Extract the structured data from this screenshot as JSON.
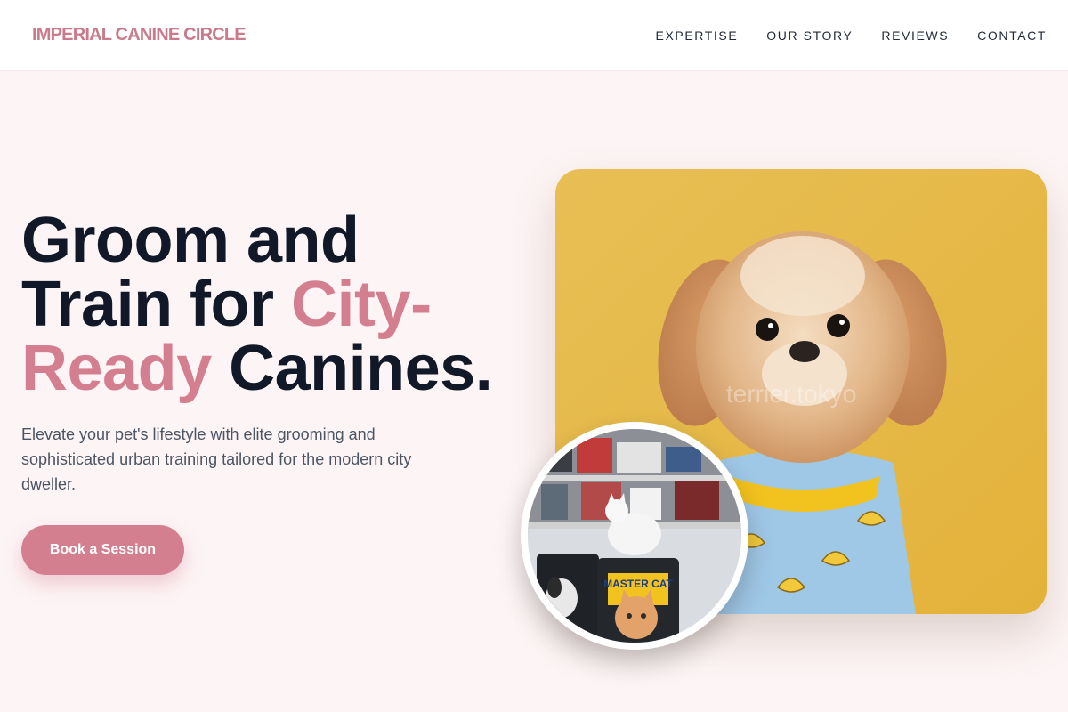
{
  "brand": {
    "name": "IMPERIAL CANINE CIRCLE",
    "accent_color": "#d47f8f"
  },
  "nav": {
    "links": [
      {
        "label": "EXPERTISE"
      },
      {
        "label": "OUR STORY"
      },
      {
        "label": "REVIEWS"
      },
      {
        "label": "CONTACT"
      }
    ]
  },
  "hero": {
    "title_line1": "Groom and",
    "title_line2_a": "Train for ",
    "title_accent_a": "City-",
    "title_accent_b": "Ready",
    "title_line3_b": " Canines.",
    "subtitle": "Elevate your pet's lifestyle with elite grooming and sophisticated urban training tailored for the modern city dweller.",
    "cta_label": "Book a Session"
  },
  "images": {
    "main": {
      "subject": "small fluffy dog in a banana-print shirt on a yellow backdrop",
      "watermark": "terrier.tokyo"
    },
    "inset": {
      "subject": "cats sitting on pet food bins in a shop",
      "bin_label": "MASTER CAT"
    }
  }
}
